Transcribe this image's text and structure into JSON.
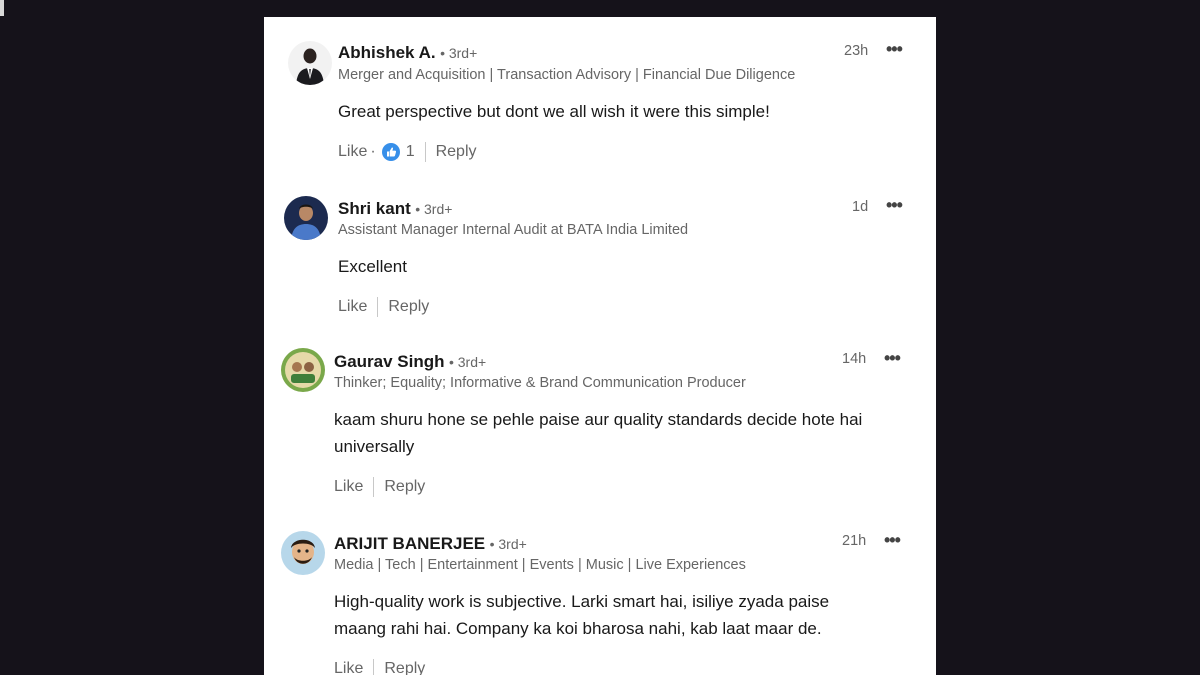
{
  "colors": {
    "background": "#15121a",
    "panel": "#ffffff",
    "primary_text": "#191919",
    "secondary_text": "#666666",
    "like_blue": "#378fe9"
  },
  "comments": [
    {
      "name": "Abhishek A.",
      "degree": "• 3rd+",
      "headline": "Merger and Acquisition | Transaction Advisory | Financial Due Diligence",
      "time": "23h",
      "more_icon": "ellipsis-icon",
      "body": "Great perspective but dont we all wish it were this simple!",
      "like_label": "Like",
      "like_dot": "·",
      "reaction_icon": "like-reaction-icon",
      "reaction_count": "1",
      "reply_label": "Reply"
    },
    {
      "name": "Shri kant",
      "degree": "• 3rd+",
      "headline": "Assistant Manager Internal Audit at BATA India Limited",
      "time": "1d",
      "more_icon": "ellipsis-icon",
      "body": "Excellent",
      "like_label": "Like",
      "reply_label": "Reply"
    },
    {
      "name": "Gaurav Singh",
      "degree": "• 3rd+",
      "headline": "Thinker; Equality; Informative & Brand Communication Producer",
      "time": "14h",
      "more_icon": "ellipsis-icon",
      "body_lines": [
        "kaam shuru hone se pehle paise aur quality standards decide hote hai",
        "universally"
      ],
      "like_label": "Like",
      "reply_label": "Reply"
    },
    {
      "name": "ARIJIT BANERJEE",
      "degree": "• 3rd+",
      "headline": "Media | Tech | Entertainment | Events | Music | Live Experiences",
      "time": "21h",
      "more_icon": "ellipsis-icon",
      "body_lines": [
        "High-quality work is subjective. Larki smart hai, isiliye zyada paise",
        "maang rahi hai. Company ka koi bharosa nahi, kab laat maar de."
      ],
      "like_label": "Like",
      "reply_label": "Reply"
    }
  ]
}
